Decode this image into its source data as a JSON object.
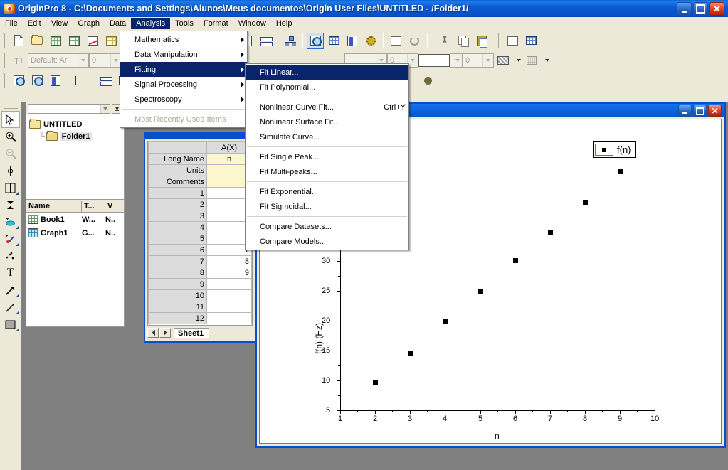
{
  "titlebar": {
    "title": "OriginPro 8 - C:\\Documents and Settings\\Alunos\\Meus documentos\\Origin User Files\\UNTITLED - /Folder1/",
    "minimize": "_",
    "maximize": "□",
    "close": "✕"
  },
  "menubar": {
    "items": [
      {
        "label": "File"
      },
      {
        "label": "Edit"
      },
      {
        "label": "View"
      },
      {
        "label": "Graph"
      },
      {
        "label": "Data"
      },
      {
        "label": "Analysis"
      },
      {
        "label": "Tools"
      },
      {
        "label": "Format"
      },
      {
        "label": "Window"
      },
      {
        "label": "Help"
      }
    ]
  },
  "analysis_menu": {
    "items": [
      {
        "label": "Mathematics",
        "submenu": true,
        "disabled": false,
        "selected": false
      },
      {
        "label": "Data Manipulation",
        "submenu": true,
        "disabled": false,
        "selected": false
      },
      {
        "label": "Fitting",
        "submenu": true,
        "disabled": false,
        "selected": true
      },
      {
        "label": "Signal Processing",
        "submenu": true,
        "disabled": false,
        "selected": false
      },
      {
        "label": "Spectroscopy",
        "submenu": true,
        "disabled": false,
        "selected": false
      },
      {
        "label": "Most Recently Used Items",
        "submenu": false,
        "disabled": true,
        "selected": false
      }
    ]
  },
  "fitting_menu": {
    "items": [
      {
        "label": "Fit Linear...",
        "accel": "",
        "selected": true
      },
      {
        "label": "Fit Polynomial...",
        "accel": "",
        "selected": false
      },
      {
        "sep": true
      },
      {
        "label": "Nonlinear Curve Fit...",
        "accel": "Ctrl+Y",
        "selected": false
      },
      {
        "label": "Nonlinear Surface Fit...",
        "accel": "",
        "selected": false
      },
      {
        "label": "Simulate Curve...",
        "accel": "",
        "selected": false
      },
      {
        "sep": true
      },
      {
        "label": "Fit Single Peak...",
        "accel": "",
        "selected": false
      },
      {
        "label": "Fit Multi-peaks...",
        "accel": "",
        "selected": false
      },
      {
        "sep": true
      },
      {
        "label": "Fit Exponential...",
        "accel": "",
        "selected": false
      },
      {
        "label": "Fit Sigmoidal...",
        "accel": "",
        "selected": false
      },
      {
        "sep": true
      },
      {
        "label": "Compare Datasets...",
        "accel": "",
        "selected": false
      },
      {
        "label": "Compare Models...",
        "accel": "",
        "selected": false
      }
    ]
  },
  "toolbars": {
    "standard": [
      "new-project-icon",
      "open-project-icon",
      "new-workbook-icon",
      "import-wizard-icon",
      "new-graph-icon",
      "new-matrix-icon",
      "new-function-icon"
    ],
    "standard2": [
      "import-single-ascii-icon",
      "import-multiple-ascii-icon",
      "import-wizard2-icon",
      "print-icon",
      "new-notes-icon",
      "layer-management-icon",
      "project-explorer-tree-icon",
      "results-log-icon",
      "data-display-icon",
      "script-window-icon",
      "code-builder-icon",
      "add-layer-icon",
      "refresh-icon"
    ],
    "edit": [
      "cut-icon",
      "copy-icon",
      "paste-icon",
      "duplicate-icon",
      "add-table-icon"
    ],
    "format": {
      "font_name": "Default: Ar",
      "font_size": "0",
      "line_size": "0",
      "fill_value": "0"
    }
  },
  "vertical_tools": [
    {
      "name": "pointer-tool",
      "selected": true
    },
    {
      "name": "zoom-in-tool",
      "selected": false
    },
    {
      "name": "zoom-out-tool",
      "selected": false
    },
    {
      "name": "screen-reader-tool",
      "selected": false
    },
    {
      "name": "data-reader-tool",
      "selected": false
    },
    {
      "name": "data-selector-tool",
      "selected": false
    },
    {
      "name": "draw-data-tool",
      "selected": false
    },
    {
      "name": "regional-mask-tool",
      "selected": false
    },
    {
      "name": "scatter-tool",
      "selected": false
    },
    {
      "name": "text-tool",
      "selected": false
    },
    {
      "name": "arrow-tool",
      "selected": false
    },
    {
      "name": "line-tool",
      "selected": false
    },
    {
      "name": "rectangle-tool",
      "selected": false
    }
  ],
  "project_explorer": {
    "address": "",
    "close_label": "x",
    "tree": [
      {
        "label": "UNTITLED",
        "level": 0,
        "selected": false
      },
      {
        "label": "Folder1",
        "level": 1,
        "selected": true
      }
    ],
    "list_headers": [
      "Name",
      "T...",
      "V"
    ],
    "list_rows": [
      {
        "name": "Book1",
        "type": "W...",
        "view": "N..",
        "icon": "workbook-icon"
      },
      {
        "name": "Graph1",
        "type": "G...",
        "view": "N..",
        "icon": "graph-icon"
      }
    ]
  },
  "workbook": {
    "title": "",
    "column_header": "A(X)",
    "row_labels": [
      "Long Name",
      "Units",
      "Comments",
      "1",
      "2",
      "3",
      "4",
      "5",
      "6",
      "7",
      "8",
      "9",
      "10",
      "11",
      "12"
    ],
    "meta_values": [
      "n",
      "",
      ""
    ],
    "cell_values": [
      "",
      "",
      "",
      "",
      "",
      "7",
      "8",
      "9",
      "",
      "",
      "",
      ""
    ],
    "sheet_tab": "Sheet1",
    "nav_prev": "◀",
    "nav_next": "▶"
  },
  "graph_window": {
    "title": "",
    "minimize": "_",
    "maximize": "□",
    "close": "✕"
  },
  "chart_data": {
    "type": "scatter",
    "title": "",
    "xlabel": "n",
    "ylabel": "f(n) (Hz)",
    "xlim": [
      1,
      10
    ],
    "ylim": [
      5,
      32
    ],
    "xticks": [
      1,
      2,
      3,
      4,
      5,
      6,
      7,
      8,
      9,
      10
    ],
    "yticks": [
      5,
      10,
      15,
      20,
      25,
      30
    ],
    "grid": false,
    "legend": {
      "position": "top-right",
      "entries": [
        "f(n)"
      ]
    },
    "series": [
      {
        "name": "f(n)",
        "marker": "square",
        "color": "#000000",
        "x": [
          2,
          3,
          4,
          5,
          6,
          7,
          8,
          9
        ],
        "y": [
          9.8,
          14.7,
          19.9,
          25.0,
          30.2,
          35.0,
          40.0,
          45.0
        ]
      }
    ]
  }
}
